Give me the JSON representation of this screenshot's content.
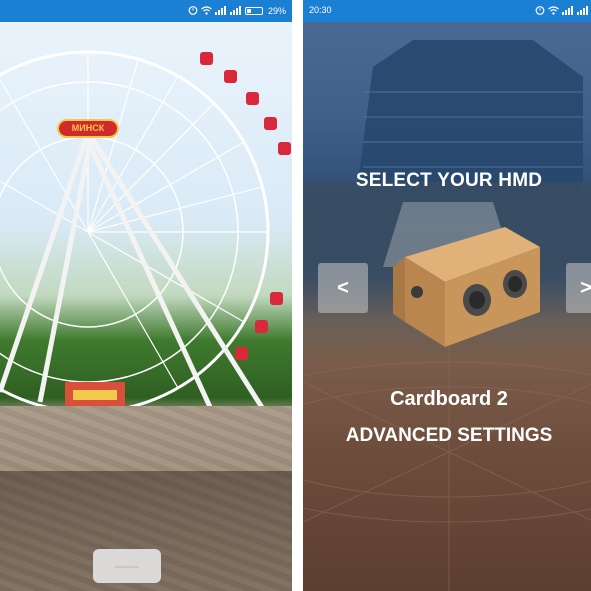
{
  "left_screen": {
    "status_bar": {
      "time": "",
      "battery": "29%"
    },
    "ferris_sign": "МИНСК"
  },
  "right_screen": {
    "status_bar": {
      "time": "20:30"
    },
    "title": "SELECT YOUR HMD",
    "prev_label": "<",
    "next_label": ">",
    "hmd_name": "Cardboard 2",
    "advanced_settings_label": "ADVANCED SETTINGS"
  },
  "colors": {
    "status_bar": "#1b7fd4",
    "nav_button_bg": "#c8c8c8",
    "viewer": "#c8955a"
  },
  "icons": [
    "alarm-icon",
    "wifi-icon",
    "signal-icon",
    "battery-icon",
    "cardboard-viewer-icon"
  ]
}
